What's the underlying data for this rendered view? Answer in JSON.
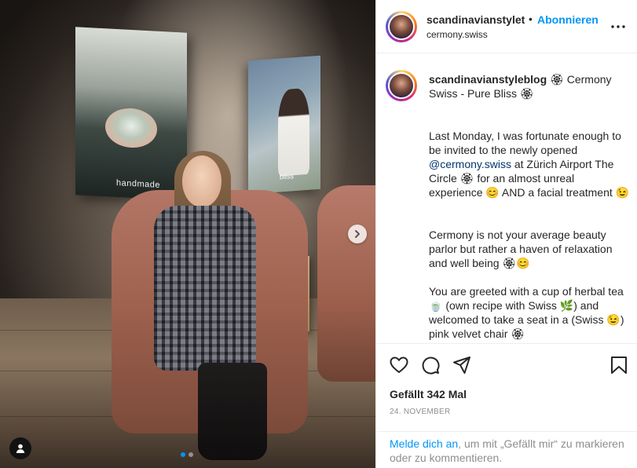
{
  "post": {
    "username": "scandinavianstyleblog",
    "header_username": "scandinavianstylet",
    "separator": "•",
    "follow_label": "Abonnieren",
    "location": "cermony.swiss"
  },
  "photo": {
    "poster_left_caption": "handmade",
    "poster_right_caption": "bliss",
    "carousel_count": 2,
    "carousel_index": 0
  },
  "caption": {
    "line1_text": "🏵 Cermony Swiss - Pure Bliss 🏵",
    "p1_before": "Last Monday, I was fortunate enough to be invited to the newly opened ",
    "p1_mention": "@cermony.swiss",
    "p1_after": " at Zürich Airport The Circle 🏵 for an almost unreal experience 😊 AND a facial treatment 😉",
    "p2": "Cermony is not your average beauty parlor but rather a haven of relaxation and well being 🏵😊",
    "p3": "You are greeted with a cup of herbal tea 🍵 (own recipe with Swiss 🌿) and welcomed to take a seat in a (Swiss 😉) pink velvet chair 🏵"
  },
  "stats": {
    "likes": "Gefällt 342 Mal",
    "date": "24. NOVEMBER"
  },
  "login": {
    "link": "Melde dich an",
    "rest": ", um mit „Gefällt mir“ zu markieren oder zu kommentieren."
  },
  "icons": {
    "like": "heart-icon",
    "comment": "comment-icon",
    "share": "paper-plane-icon",
    "save": "bookmark-icon",
    "more": "more-dots-icon",
    "next": "chevron-right-icon",
    "tag": "user-tag-icon"
  },
  "colors": {
    "accent": "#0095f6",
    "mention": "#00376b",
    "muted": "#8e8e8e",
    "text": "#262626"
  }
}
